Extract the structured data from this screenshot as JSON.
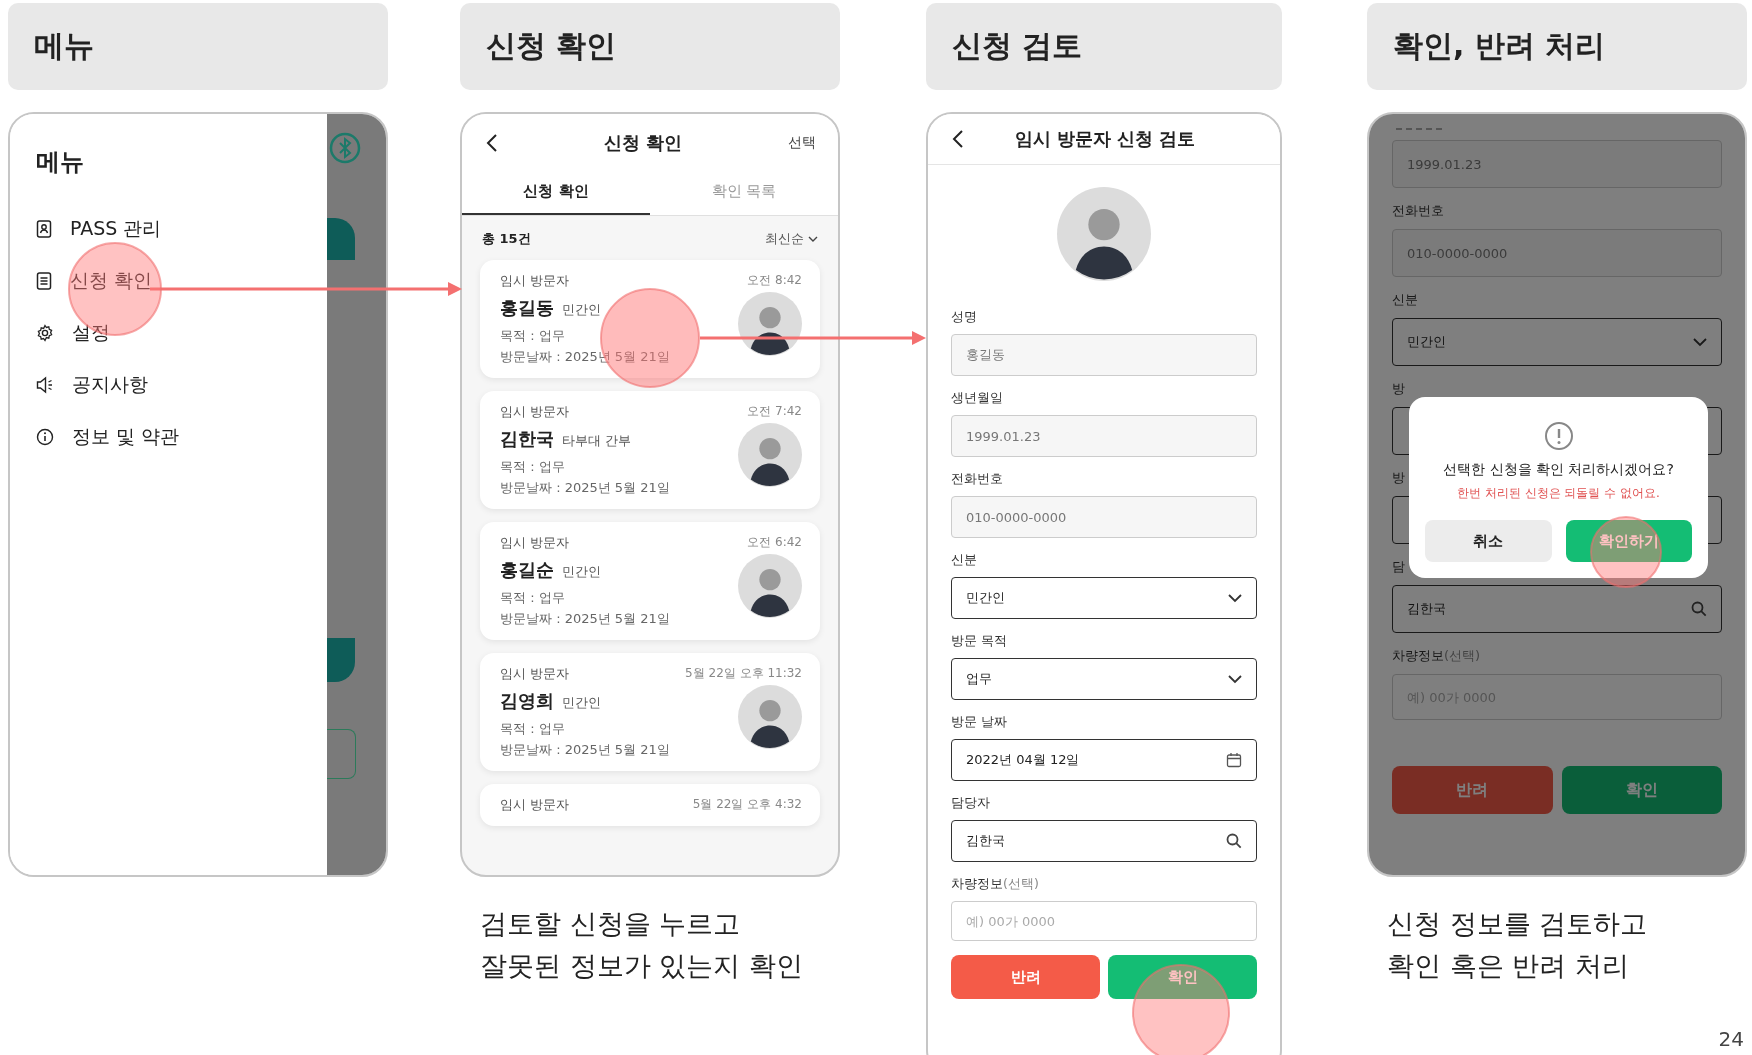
{
  "step_headers": [
    "메뉴",
    "신청 확인",
    "신청 검토",
    "확인, 반려 처리"
  ],
  "menu_screen": {
    "title": "메뉴",
    "items": [
      {
        "label": "PASS 관리"
      },
      {
        "label": "신청 확인"
      },
      {
        "label": "설정"
      },
      {
        "label": "공지사항"
      },
      {
        "label": "정보 및 약관"
      }
    ]
  },
  "list_screen": {
    "title": "신청 확인",
    "action": "선택",
    "tabs": [
      {
        "label": "신청 확인",
        "selected": true
      },
      {
        "label": "확인 목록",
        "selected": false
      }
    ],
    "count": "총 15건",
    "sort": "최신순",
    "cards": [
      {
        "type": "임시 방문자",
        "time": "오전 8:42",
        "name": "홍길동",
        "role": "민간인",
        "purpose": "목적 : 업무",
        "date": "방문날짜 : 2025년 5월 21일"
      },
      {
        "type": "임시 방문자",
        "time": "오전 7:42",
        "name": "김한국",
        "role": "타부대 간부",
        "purpose": "목적 : 업무",
        "date": "방문날짜 : 2025년 5월 21일"
      },
      {
        "type": "임시 방문자",
        "time": "오전 6:42",
        "name": "홍길순",
        "role": "민간인",
        "purpose": "목적 : 업무",
        "date": "방문날짜 : 2025년 5월 21일"
      },
      {
        "type": "임시 방문자",
        "time": "5월 22일 오후 11:32",
        "name": "김영희",
        "role": "민간인",
        "purpose": "목적 : 업무",
        "date": "방문날짜 : 2025년 5월 21일"
      },
      {
        "type": "임시 방문자",
        "time": "5월 22일 오후 4:32"
      }
    ]
  },
  "caption_list": [
    "검토할 신청을 누르고",
    "잘못된 정보가 있는지 확인"
  ],
  "review_screen": {
    "title": "임시 방문자 신청 검토",
    "fields": [
      {
        "label": "성명",
        "kind": "readonly",
        "value": "홍길동"
      },
      {
        "label": "생년월일",
        "kind": "readonly",
        "value": "1999.01.23"
      },
      {
        "label": "전화번호",
        "kind": "readonly",
        "value": "010-0000-0000"
      },
      {
        "label": "신분",
        "kind": "select",
        "value": "민간인"
      },
      {
        "label": "방문 목적",
        "kind": "select",
        "value": "업무"
      },
      {
        "label": "방문 날짜",
        "kind": "date",
        "value": "2022년 04월 12일"
      },
      {
        "label": "담당자",
        "kind": "search",
        "value": "김한국"
      },
      {
        "label": "차량정보",
        "hint": "(선택)",
        "kind": "input",
        "placeholder": "예) 00가 0000"
      }
    ],
    "buttons": [
      {
        "kind": "reject",
        "label": "반려"
      },
      {
        "kind": "confirm",
        "label": "확인"
      }
    ]
  },
  "confirm_screen": {
    "fields": [
      {
        "kind": "readonly",
        "value": "1999.01.23"
      },
      {
        "label": "전화번호",
        "kind": "readonly",
        "value": "010-0000-0000"
      },
      {
        "label": "신분",
        "kind": "select",
        "value": "민간인"
      },
      {
        "label": "방",
        "kind": "blank"
      },
      {
        "label": "방",
        "kind": "blank"
      },
      {
        "label": "담",
        "kind": "search",
        "value": "김한국"
      },
      {
        "label": "차량정보",
        "hint": "(선택)",
        "kind": "input",
        "placeholder": "예) 00가 0000"
      }
    ],
    "buttons": [
      {
        "kind": "reject",
        "label": "반려"
      },
      {
        "kind": "confirm",
        "label": "확인"
      }
    ],
    "dialog": {
      "message": "선택한 신청을 확인 처리하시겠어요?",
      "warning": "한번 처리된 신청은 되돌릴 수 없어요.",
      "buttons": [
        {
          "kind": "cancel",
          "label": "취소"
        },
        {
          "kind": "confirm",
          "label": "확인하기"
        }
      ]
    }
  },
  "caption_confirm": [
    "신청 정보를 검토하고",
    "확인 혹은 반려 처리"
  ],
  "page_number": "24"
}
